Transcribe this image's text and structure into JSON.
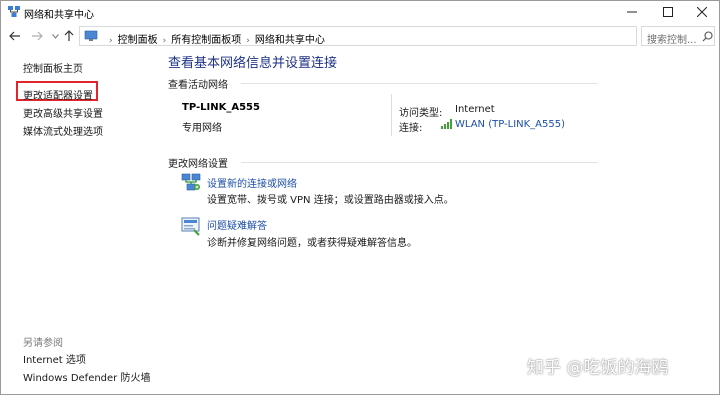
{
  "window": {
    "title": "网络和共享中心",
    "minimize_icon": "minimize-icon",
    "maximize_icon": "maximize-icon",
    "close_icon": "close-icon"
  },
  "address_bar": {
    "breadcrumbs": [
      "控制面板",
      "所有控制面板项",
      "网络和共享中心"
    ],
    "search_placeholder": "搜索控制..."
  },
  "left_pane": {
    "home": "控制面板主页",
    "adapter_settings": "更改适配器设置",
    "advanced_sharing": "更改高级共享设置",
    "media_streaming": "媒体流式处理选项",
    "see_also": "另请参阅",
    "internet_options": "Internet 选项",
    "firewall": "Windows Defender 防火墙"
  },
  "main": {
    "title": "查看基本网络信息并设置连接",
    "active_networks_label": "查看活动网络",
    "network_name": "TP-LINK_A555",
    "network_type": "专用网络",
    "access_type_label": "访问类型:",
    "access_type_value": "Internet",
    "connections_label": "连接:",
    "connections_value": "WLAN (TP-LINK_A555)",
    "change_settings_label": "更改网络设置",
    "tasks": [
      {
        "title": "设置新的连接或网络",
        "desc": "设置宽带、拨号或 VPN 连接；或设置路由器或接入点。"
      },
      {
        "title": "问题疑难解答",
        "desc": "诊断并修复网络问题，或者获得疑难解答信息。"
      }
    ]
  },
  "watermark": "知乎 @吃饭的海鸥",
  "colors": {
    "link": "#1c4fa8",
    "title": "#1e3287",
    "highlight_border": "#e0262b"
  }
}
